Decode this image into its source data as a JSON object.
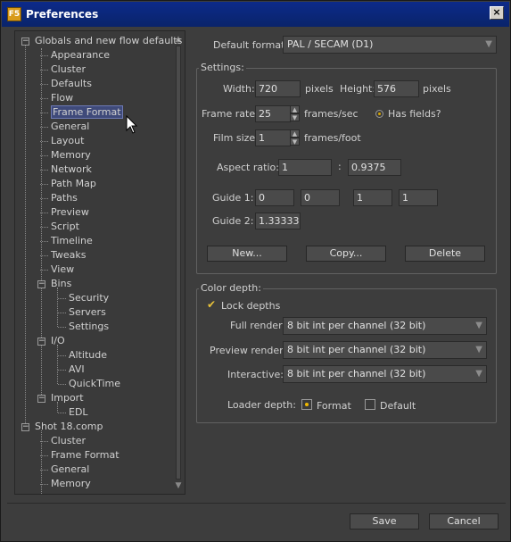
{
  "window": {
    "title": "Preferences",
    "app_icon": "F5",
    "close": "×"
  },
  "tree": {
    "nodes": [
      {
        "label": "Globals and new flow defaults",
        "level": 0,
        "expander": "−"
      },
      {
        "label": "Appearance",
        "level": 1
      },
      {
        "label": "Cluster",
        "level": 1
      },
      {
        "label": "Defaults",
        "level": 1
      },
      {
        "label": "Flow",
        "level": 1
      },
      {
        "label": "Frame Format",
        "level": 1,
        "selected": true
      },
      {
        "label": "General",
        "level": 1
      },
      {
        "label": "Layout",
        "level": 1
      },
      {
        "label": "Memory",
        "level": 1
      },
      {
        "label": "Network",
        "level": 1
      },
      {
        "label": "Path Map",
        "level": 1
      },
      {
        "label": "Paths",
        "level": 1
      },
      {
        "label": "Preview",
        "level": 1
      },
      {
        "label": "Script",
        "level": 1
      },
      {
        "label": "Timeline",
        "level": 1
      },
      {
        "label": "Tweaks",
        "level": 1
      },
      {
        "label": "View",
        "level": 1
      },
      {
        "label": "Bins",
        "level": 1,
        "expander": "−"
      },
      {
        "label": "Security",
        "level": 2
      },
      {
        "label": "Servers",
        "level": 2
      },
      {
        "label": "Settings",
        "level": 2
      },
      {
        "label": "I/O",
        "level": 1,
        "expander": "−"
      },
      {
        "label": "Altitude",
        "level": 2
      },
      {
        "label": "AVI",
        "level": 2
      },
      {
        "label": "QuickTime",
        "level": 2
      },
      {
        "label": "Import",
        "level": 1,
        "expander": "−"
      },
      {
        "label": "EDL",
        "level": 2
      },
      {
        "label": "Shot 18.comp",
        "level": 0,
        "expander": "−"
      },
      {
        "label": "Cluster",
        "level": 1
      },
      {
        "label": "Frame Format",
        "level": 1
      },
      {
        "label": "General",
        "level": 1
      },
      {
        "label": "Memory",
        "level": 1
      }
    ]
  },
  "default_format": {
    "label": "Default format:",
    "value": "PAL / SECAM (D1)"
  },
  "settings": {
    "title": "Settings:",
    "width_label": "Width:",
    "width": "720",
    "width_unit": "pixels",
    "height_label": "Height:",
    "height": "576",
    "height_unit": "pixels",
    "frame_rate_label": "Frame rate:",
    "frame_rate": "25",
    "frame_rate_unit": "frames/sec",
    "has_fields_label": "Has fields?",
    "film_size_label": "Film size:",
    "film_size": "1",
    "film_size_unit": "frames/foot",
    "aspect_label": "Aspect ratio:",
    "aspect_x": "1",
    "aspect_sep": ":",
    "aspect_y": "0.9375",
    "guide1_label": "Guide 1:",
    "guide1": [
      "0",
      "0",
      "1",
      "1"
    ],
    "guide2_label": "Guide 2:",
    "guide2": "1.333333",
    "new_button": "New...",
    "copy_button": "Copy...",
    "delete_button": "Delete"
  },
  "color_depth": {
    "title": "Color depth:",
    "lock_depths_label": "Lock depths",
    "lock_depths_checked": true,
    "full_render_label": "Full render:",
    "full_render": "8 bit int per channel (32 bit)",
    "preview_render_label": "Preview render:",
    "preview_render": "8 bit int per channel (32 bit)",
    "interactive_label": "Interactive:",
    "interactive": "8 bit int per channel (32 bit)",
    "loader_depth_label": "Loader depth:",
    "loader_format_label": "Format",
    "loader_format_selected": true,
    "loader_default_label": "Default"
  },
  "footer": {
    "save": "Save",
    "cancel": "Cancel"
  }
}
